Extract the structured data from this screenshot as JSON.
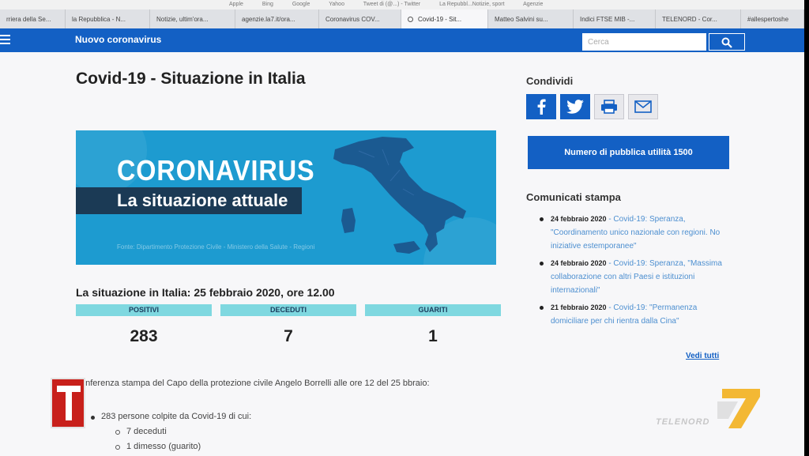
{
  "browser": {
    "bookmarks": [
      "Apple",
      "Bing",
      "Google",
      "Yahoo",
      "Tweet di (@...) - Twitter",
      "La Repubbl...Notizie, sport",
      "Agenzie"
    ],
    "tabs": [
      {
        "label": "rriera della Se..."
      },
      {
        "label": "la Repubblica - N..."
      },
      {
        "label": "Notizie, ultim'ora..."
      },
      {
        "label": "agenzie.la7.it/ora..."
      },
      {
        "label": "Coronavirus COV..."
      },
      {
        "label": "Covid-19 - Sit...",
        "active": true
      },
      {
        "label": "Matteo Salvini su..."
      },
      {
        "label": "Indici FTSE MIB -..."
      },
      {
        "label": "TELENORD - Cor..."
      },
      {
        "label": "#allespertoshe"
      }
    ]
  },
  "header": {
    "site_title": "Nuovo coronavirus",
    "search_placeholder": "Cerca",
    "brand_color": "#1360c4"
  },
  "main": {
    "page_title": "Covid-19 - Situazione in Italia",
    "hero": {
      "title": "CORONAVIRUS",
      "subtitle": "La situazione attuale",
      "source": "Fonte: Dipartimento Protezione Civile - Ministero della Salute - Regioni"
    },
    "situazione_heading": "La situazione in Italia: 25 febbraio 2020, ore 12.00",
    "stats": [
      {
        "label": "POSITIVI",
        "value": "283"
      },
      {
        "label": "DECEDUTI",
        "value": "7"
      },
      {
        "label": "GUARITI",
        "value": "1"
      }
    ],
    "press_text": "onferenza stampa del Capo della protezione civile Angelo Borrelli alle ore 12 del 25 bbraio:",
    "bullets": {
      "main": "283 persone colpite da Covid-19 di cui:",
      "sub": [
        "7 deceduti",
        "1 dimesso (guarito)"
      ]
    }
  },
  "sidebar": {
    "share_heading": "Condividi",
    "share_icons": [
      "facebook-icon",
      "twitter-icon",
      "print-icon",
      "mail-icon"
    ],
    "public_utility_button": "Numero di pubblica utilità 1500",
    "comunicati_heading": "Comunicati stampa",
    "news": [
      {
        "date": "24 febbraio 2020",
        "source": " - Covid-19: Speranza,",
        "text": "\"Coordinamento unico nazionale con regioni. No iniziative estemporanee\""
      },
      {
        "date": "24 febbraio 2020",
        "source": " - Covid-19: Speranza,",
        "text": "\"Massima collaborazione con altri Paesi e istituzioni internazionali\""
      },
      {
        "date": "21 febbraio 2020",
        "source": " - Covid-19:",
        "text": "\"Permanenza domiciliare per chi rientra dalla Cina\""
      }
    ],
    "vedi_tutti": "Vedi tutti"
  },
  "overlay": {
    "channel_text": "TELENORD"
  }
}
